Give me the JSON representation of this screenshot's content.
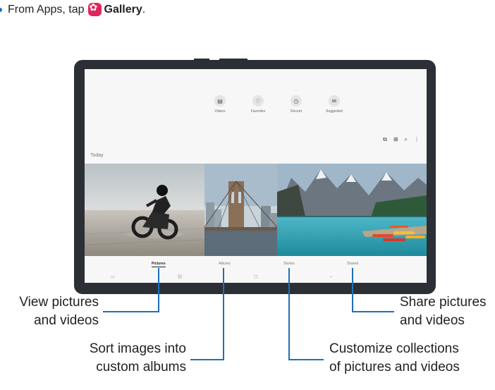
{
  "instruction": {
    "prefix": "From Apps, tap",
    "app_name": "Gallery"
  },
  "gallery": {
    "categories": [
      {
        "label": "Videos",
        "icon": "video-icon"
      },
      {
        "label": "Favorites",
        "icon": "heart-icon"
      },
      {
        "label": "Recent",
        "icon": "clock-icon"
      },
      {
        "label": "Suggested",
        "icon": "suggested-icon"
      }
    ],
    "section_label": "Today",
    "tabs": [
      "Pictures",
      "Albums",
      "Stories",
      "Shared"
    ],
    "active_tab": "Pictures",
    "photos": [
      "motorcycle-desert-photo",
      "bridge-photo",
      "mountain-lake-photo"
    ]
  },
  "callouts": {
    "pictures": [
      "View pictures",
      "and videos"
    ],
    "albums": [
      "Sort images into",
      "custom albums"
    ],
    "stories": [
      "Customize collections",
      "of pictures and videos"
    ],
    "shared": [
      "Share pictures",
      "and videos"
    ]
  },
  "colors": {
    "accent": "#1e6fb8",
    "gallery_icon": "#e0245e",
    "tablet_frame": "#2c2f35"
  }
}
